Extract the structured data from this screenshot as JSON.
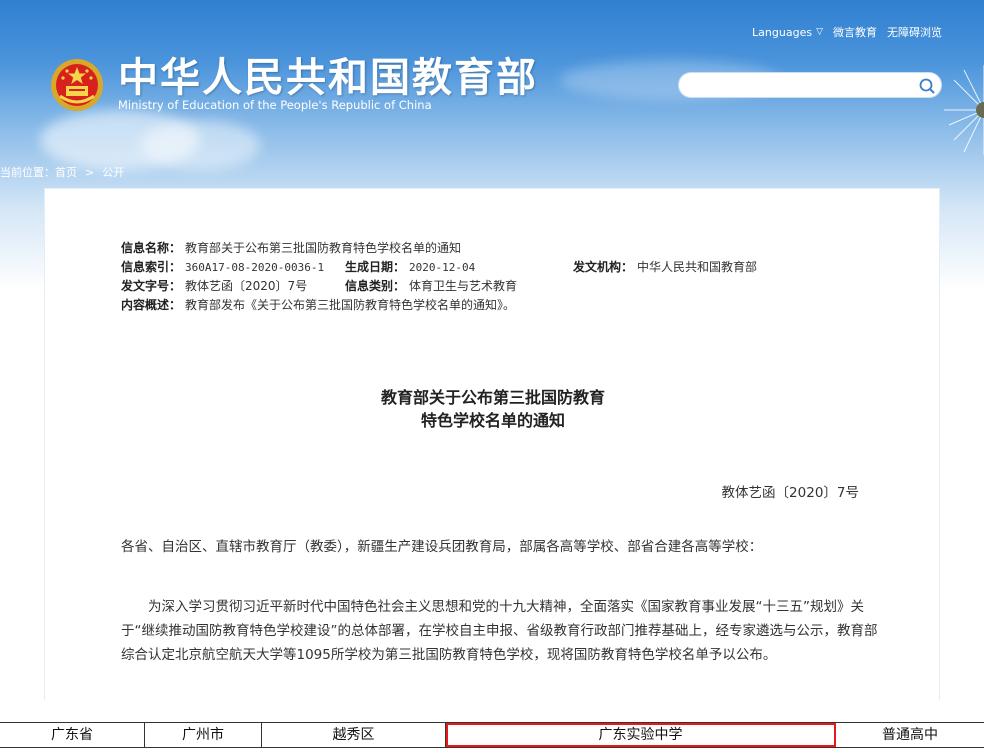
{
  "header": {
    "top_links": [
      "Languages",
      "微言教育",
      "无障碍浏览"
    ],
    "site_title": "中华人民共和国教育部",
    "site_subtitle": "Ministry of Education of the People's Republic of China",
    "search_placeholder": ""
  },
  "breadcrumb": {
    "prefix": "当前位置：",
    "items": [
      "首页",
      "公开"
    ],
    "separator": ">"
  },
  "meta": {
    "name_label": "信息名称：",
    "name_value": "教育部关于公布第三批国防教育特色学校名单的通知",
    "index_label": "信息索引：",
    "index_value": "360A17-08-2020-0036-1",
    "date_label": "生成日期：",
    "date_value": "2020-12-04",
    "issuer_label": "发文机构：",
    "issuer_value": "中华人民共和国教育部",
    "doc_no_label": "发文字号：",
    "doc_no_value": "教体艺函〔2020〕7号",
    "category_label": "信息类别：",
    "category_value": "体育卫生与艺术教育",
    "summary_label": "内容概述：",
    "summary_value": "教育部发布《关于公布第三批国防教育特色学校名单的通知》。"
  },
  "document": {
    "title_line1": "教育部关于公布第三批国防教育",
    "title_line2": "特色学校名单的通知",
    "doc_number": "教体艺函〔2020〕7号",
    "salutation": "各省、自治区、直辖市教育厅（教委），新疆生产建设兵团教育局，部属各高等学校、部省合建各高等学校：",
    "paragraph1": "为深入学习贯彻习近平新时代中国特色社会主义思想和党的十九大精神，全面落实《国家教育事业发展“十三五”规划》关于“继续推动国防教育特色学校建设”的总体部署，在学校自主申报、省级教育行政部门推荐基础上，经专家遴选与公示，教育部综合认定北京航空航天大学等1095所学校为第三批国防教育特色学校，现将国防教育特色学校名单予以公布。"
  },
  "table_row": [
    "广东省",
    "广州市",
    "越秀区",
    "广东实验中学",
    "普通高中"
  ],
  "colors": {
    "header_blue": "#2f7fd0",
    "highlight_red": "#e8181b"
  }
}
